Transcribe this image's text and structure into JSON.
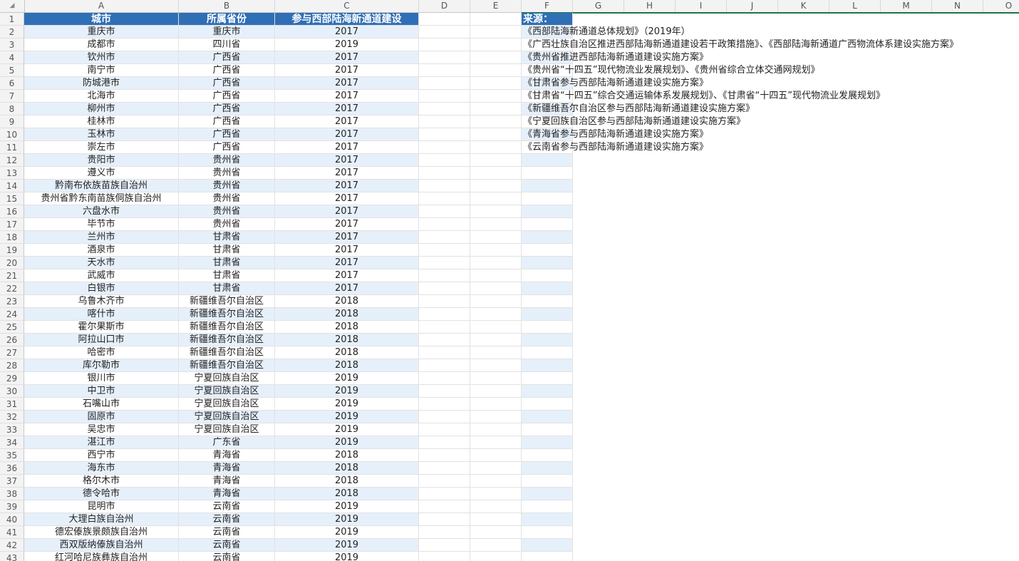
{
  "corner_icon": "select-all-triangle",
  "columns": [
    "A",
    "B",
    "C",
    "D",
    "E",
    "F",
    "G",
    "H",
    "I",
    "J",
    "K",
    "L",
    "M",
    "N",
    "O"
  ],
  "header": {
    "city": "城市",
    "province": "所属省份",
    "year": "参与西部陆海新通道建设",
    "source": "来源："
  },
  "rows": [
    {
      "num": "2",
      "city": "重庆市",
      "prov": "重庆市",
      "year": "2017",
      "src": "《西部陆海新通道总体规划》（2019年）"
    },
    {
      "num": "3",
      "city": "成都市",
      "prov": "四川省",
      "year": "2019",
      "src": "《广西壮族自治区推进西部陆海新通道建设若干政策措施》、《西部陆海新通道广西物流体系建设实施方案》"
    },
    {
      "num": "4",
      "city": "钦州市",
      "prov": "广西省",
      "year": "2017",
      "src": "《贵州省推进西部陆海新通道建设实施方案》"
    },
    {
      "num": "5",
      "city": "南宁市",
      "prov": "广西省",
      "year": "2017",
      "src": "《贵州省“十四五”现代物流业发展规划》、《贵州省综合立体交通网规划》"
    },
    {
      "num": "6",
      "city": "防城港市",
      "prov": "广西省",
      "year": "2017",
      "src": "《甘肃省参与西部陆海新通道建设实施方案》"
    },
    {
      "num": "7",
      "city": "北海市",
      "prov": "广西省",
      "year": "2017",
      "src": "《甘肃省“十四五”综合交通运输体系发展规划》、《甘肃省“十四五”现代物流业发展规划》"
    },
    {
      "num": "8",
      "city": "柳州市",
      "prov": "广西省",
      "year": "2017",
      "src": "《新疆维吾尔自治区参与西部陆海新通道建设实施方案》"
    },
    {
      "num": "9",
      "city": "桂林市",
      "prov": "广西省",
      "year": "2017",
      "src": "《宁夏回族自治区参与西部陆海新通道建设实施方案》"
    },
    {
      "num": "10",
      "city": "玉林市",
      "prov": "广西省",
      "year": "2017",
      "src": "《青海省参与西部陆海新通道建设实施方案》"
    },
    {
      "num": "11",
      "city": "崇左市",
      "prov": "广西省",
      "year": "2017",
      "src": "《云南省参与西部陆海新通道建设实施方案》"
    },
    {
      "num": "12",
      "city": "贵阳市",
      "prov": "贵州省",
      "year": "2017",
      "src": ""
    },
    {
      "num": "13",
      "city": "遵义市",
      "prov": "贵州省",
      "year": "2017",
      "src": ""
    },
    {
      "num": "14",
      "city": "黔南布依族苗族自治州",
      "prov": "贵州省",
      "year": "2017",
      "src": ""
    },
    {
      "num": "15",
      "city": "贵州省黔东南苗族侗族自治州",
      "prov": "贵州省",
      "year": "2017",
      "src": ""
    },
    {
      "num": "16",
      "city": "六盘水市",
      "prov": "贵州省",
      "year": "2017",
      "src": ""
    },
    {
      "num": "17",
      "city": "毕节市",
      "prov": "贵州省",
      "year": "2017",
      "src": ""
    },
    {
      "num": "18",
      "city": "兰州市",
      "prov": "甘肃省",
      "year": "2017",
      "src": ""
    },
    {
      "num": "19",
      "city": "酒泉市",
      "prov": "甘肃省",
      "year": "2017",
      "src": ""
    },
    {
      "num": "20",
      "city": "天水市",
      "prov": "甘肃省",
      "year": "2017",
      "src": ""
    },
    {
      "num": "21",
      "city": "武威市",
      "prov": "甘肃省",
      "year": "2017",
      "src": ""
    },
    {
      "num": "22",
      "city": "白银市",
      "prov": "甘肃省",
      "year": "2017",
      "src": ""
    },
    {
      "num": "23",
      "city": "乌鲁木齐市",
      "prov": "新疆维吾尔自治区",
      "year": "2018",
      "src": ""
    },
    {
      "num": "24",
      "city": "喀什市",
      "prov": "新疆维吾尔自治区",
      "year": "2018",
      "src": ""
    },
    {
      "num": "25",
      "city": "霍尔果斯市",
      "prov": "新疆维吾尔自治区",
      "year": "2018",
      "src": ""
    },
    {
      "num": "26",
      "city": "阿拉山口市",
      "prov": "新疆维吾尔自治区",
      "year": "2018",
      "src": ""
    },
    {
      "num": "27",
      "city": "哈密市",
      "prov": "新疆维吾尔自治区",
      "year": "2018",
      "src": ""
    },
    {
      "num": "28",
      "city": "库尔勒市",
      "prov": "新疆维吾尔自治区",
      "year": "2018",
      "src": ""
    },
    {
      "num": "29",
      "city": "银川市",
      "prov": "宁夏回族自治区",
      "year": "2019",
      "src": ""
    },
    {
      "num": "30",
      "city": "中卫市",
      "prov": "宁夏回族自治区",
      "year": "2019",
      "src": ""
    },
    {
      "num": "31",
      "city": "石嘴山市",
      "prov": "宁夏回族自治区",
      "year": "2019",
      "src": ""
    },
    {
      "num": "32",
      "city": "固原市",
      "prov": "宁夏回族自治区",
      "year": "2019",
      "src": ""
    },
    {
      "num": "33",
      "city": "吴忠市",
      "prov": "宁夏回族自治区",
      "year": "2019",
      "src": ""
    },
    {
      "num": "34",
      "city": "湛江市",
      "prov": "广东省",
      "year": "2019",
      "src": ""
    },
    {
      "num": "35",
      "city": "西宁市",
      "prov": "青海省",
      "year": "2018",
      "src": ""
    },
    {
      "num": "36",
      "city": "海东市",
      "prov": "青海省",
      "year": "2018",
      "src": ""
    },
    {
      "num": "37",
      "city": "格尔木市",
      "prov": "青海省",
      "year": "2018",
      "src": ""
    },
    {
      "num": "38",
      "city": "德令哈市",
      "prov": "青海省",
      "year": "2018",
      "src": ""
    },
    {
      "num": "39",
      "city": "昆明市",
      "prov": "云南省",
      "year": "2019",
      "src": ""
    },
    {
      "num": "40",
      "city": "大理白族自治州",
      "prov": "云南省",
      "year": "2019",
      "src": ""
    },
    {
      "num": "41",
      "city": "德宏傣族景颇族自治州",
      "prov": "云南省",
      "year": "2019",
      "src": ""
    },
    {
      "num": "42",
      "city": "西双版纳傣族自治州",
      "prov": "云南省",
      "year": "2019",
      "src": ""
    },
    {
      "num": "43",
      "city": "红河哈尼族彝族自治州",
      "prov": "云南省",
      "year": "2019",
      "src": ""
    }
  ],
  "colors": {
    "header_bg": "#2f6fb5",
    "alt_row": "#e6f0fb",
    "active_col": "#217346"
  }
}
